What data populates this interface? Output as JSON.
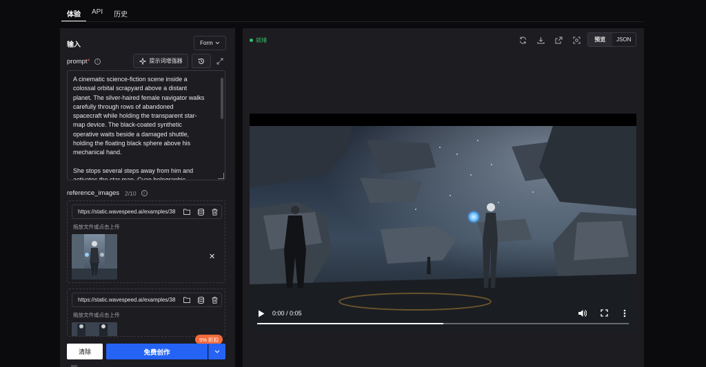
{
  "tabs": [
    {
      "label": "体验",
      "active": true
    },
    {
      "label": "API",
      "active": false
    },
    {
      "label": "历史",
      "active": false
    }
  ],
  "input_panel": {
    "title": "输入",
    "mode_select": "Form",
    "prompt": {
      "label": "prompt",
      "required_mark": "*",
      "enhance_button": "提示词增强器",
      "value": "A cinematic science-fiction scene inside a\ncolossal orbital scrapyard above a distant\nplanet. The silver-haired female navigator walks\ncarefully through rows of abandoned\nspacecraft while holding the transparent star-\nmap device. The black-coated synthetic\noperative waits beside a damaged shuttle,\nholding the floating black sphere above his\nmechanical hand.\n\nShe stops several steps away from him and\nactivates the star map. Cyan holographic"
    },
    "reference_images": {
      "label": "reference_images",
      "count": "2/10",
      "items": [
        {
          "url": "https://static.wavespeed.ai/examples/38",
          "drop_hint": "拖放文件或点击上传"
        },
        {
          "url": "https://static.wavespeed.ai/examples/38",
          "drop_hint": "拖放文件或点击上传"
        }
      ]
    },
    "actions": {
      "clear": "清除",
      "create": "免费创作",
      "discount_badge": "5% 折扣"
    }
  },
  "output_panel": {
    "status": "就绪",
    "status_color": "#33c26b",
    "view_options": [
      "预览",
      "JSON"
    ],
    "selected_view": "预览",
    "video": {
      "time": "0:00 / 0:05",
      "progress": 0.5
    }
  },
  "colors": {
    "background": "#0b0a0d",
    "panel": "#1d1c21",
    "primary": "#2563f5",
    "badge": "#f26b3a"
  }
}
